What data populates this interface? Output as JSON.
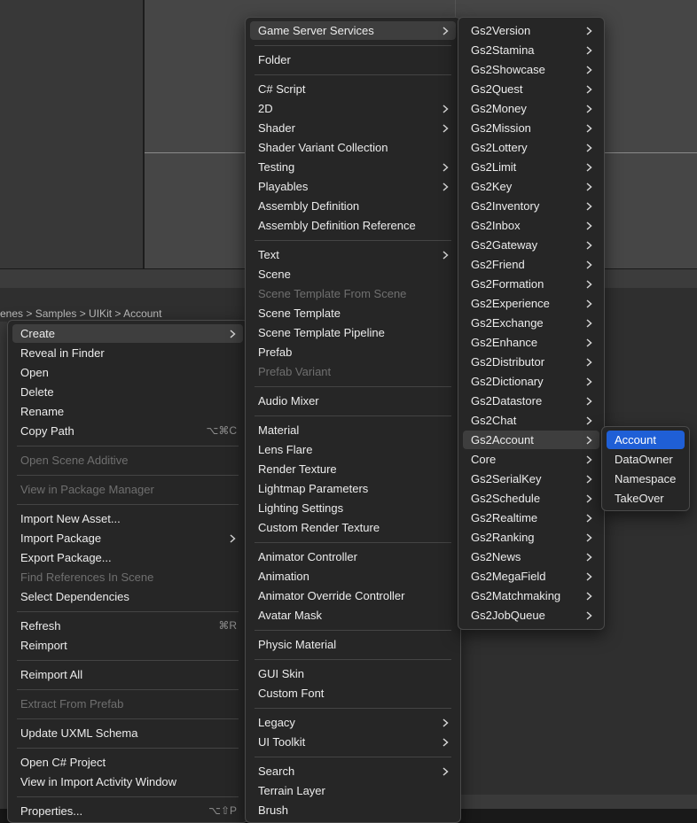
{
  "breadcrumb": "enes > Samples > UIKit > Account",
  "context_menu": {
    "items": [
      {
        "label": "Create",
        "submenu": true,
        "highlighted": true
      },
      {
        "label": "Reveal in Finder"
      },
      {
        "label": "Open"
      },
      {
        "label": "Delete"
      },
      {
        "label": "Rename"
      },
      {
        "label": "Copy Path",
        "shortcut": "⌥⌘C"
      },
      {
        "label": "Open Scene Additive",
        "disabled": true
      },
      {
        "label": "View in Package Manager",
        "disabled": true
      },
      {
        "label": "Import New Asset..."
      },
      {
        "label": "Import Package",
        "submenu": true
      },
      {
        "label": "Export Package..."
      },
      {
        "label": "Find References In Scene",
        "disabled": true
      },
      {
        "label": "Select Dependencies"
      },
      {
        "label": "Refresh",
        "shortcut": "⌘R"
      },
      {
        "label": "Reimport"
      },
      {
        "label": "Reimport All"
      },
      {
        "label": "Extract From Prefab",
        "disabled": true
      },
      {
        "label": "Update UXML Schema"
      },
      {
        "label": "Open C# Project"
      },
      {
        "label": "View in Import Activity Window"
      },
      {
        "label": "Properties...",
        "shortcut": "⌥⇧P"
      }
    ]
  },
  "create_menu": {
    "items": [
      {
        "label": "Game Server Services",
        "submenu": true,
        "highlighted": true
      },
      {
        "label": "Folder"
      },
      {
        "label": "C# Script"
      },
      {
        "label": "2D",
        "submenu": true
      },
      {
        "label": "Shader",
        "submenu": true
      },
      {
        "label": "Shader Variant Collection"
      },
      {
        "label": "Testing",
        "submenu": true
      },
      {
        "label": "Playables",
        "submenu": true
      },
      {
        "label": "Assembly Definition"
      },
      {
        "label": "Assembly Definition Reference"
      },
      {
        "label": "Text",
        "submenu": true
      },
      {
        "label": "Scene"
      },
      {
        "label": "Scene Template From Scene",
        "disabled": true
      },
      {
        "label": "Scene Template"
      },
      {
        "label": "Scene Template Pipeline"
      },
      {
        "label": "Prefab"
      },
      {
        "label": "Prefab Variant",
        "disabled": true
      },
      {
        "label": "Audio Mixer"
      },
      {
        "label": "Material"
      },
      {
        "label": "Lens Flare"
      },
      {
        "label": "Render Texture"
      },
      {
        "label": "Lightmap Parameters"
      },
      {
        "label": "Lighting Settings"
      },
      {
        "label": "Custom Render Texture"
      },
      {
        "label": "Animator Controller"
      },
      {
        "label": "Animation"
      },
      {
        "label": "Animator Override Controller"
      },
      {
        "label": "Avatar Mask"
      },
      {
        "label": "Physic Material"
      },
      {
        "label": "GUI Skin"
      },
      {
        "label": "Custom Font"
      },
      {
        "label": "Legacy",
        "submenu": true
      },
      {
        "label": "UI Toolkit",
        "submenu": true
      },
      {
        "label": "Search",
        "submenu": true
      },
      {
        "label": "Terrain Layer"
      },
      {
        "label": "Brush"
      }
    ]
  },
  "gs2_menu": {
    "items": [
      {
        "label": "Gs2Version"
      },
      {
        "label": "Gs2Stamina"
      },
      {
        "label": "Gs2Showcase"
      },
      {
        "label": "Gs2Quest"
      },
      {
        "label": "Gs2Money"
      },
      {
        "label": "Gs2Mission"
      },
      {
        "label": "Gs2Lottery"
      },
      {
        "label": "Gs2Limit"
      },
      {
        "label": "Gs2Key"
      },
      {
        "label": "Gs2Inventory"
      },
      {
        "label": "Gs2Inbox"
      },
      {
        "label": "Gs2Gateway"
      },
      {
        "label": "Gs2Friend"
      },
      {
        "label": "Gs2Formation"
      },
      {
        "label": "Gs2Experience"
      },
      {
        "label": "Gs2Exchange"
      },
      {
        "label": "Gs2Enhance"
      },
      {
        "label": "Gs2Distributor"
      },
      {
        "label": "Gs2Dictionary"
      },
      {
        "label": "Gs2Datastore"
      },
      {
        "label": "Gs2Chat"
      },
      {
        "label": "Gs2Account",
        "highlighted": true
      },
      {
        "label": "Core"
      },
      {
        "label": "Gs2SerialKey"
      },
      {
        "label": "Gs2Schedule"
      },
      {
        "label": "Gs2Realtime"
      },
      {
        "label": "Gs2Ranking"
      },
      {
        "label": "Gs2News"
      },
      {
        "label": "Gs2MegaField"
      },
      {
        "label": "Gs2Matchmaking"
      },
      {
        "label": "Gs2JobQueue"
      }
    ]
  },
  "account_menu": {
    "items": [
      {
        "label": "Account",
        "active": true
      },
      {
        "label": "DataOwner"
      },
      {
        "label": "Namespace"
      },
      {
        "label": "TakeOver"
      }
    ]
  }
}
